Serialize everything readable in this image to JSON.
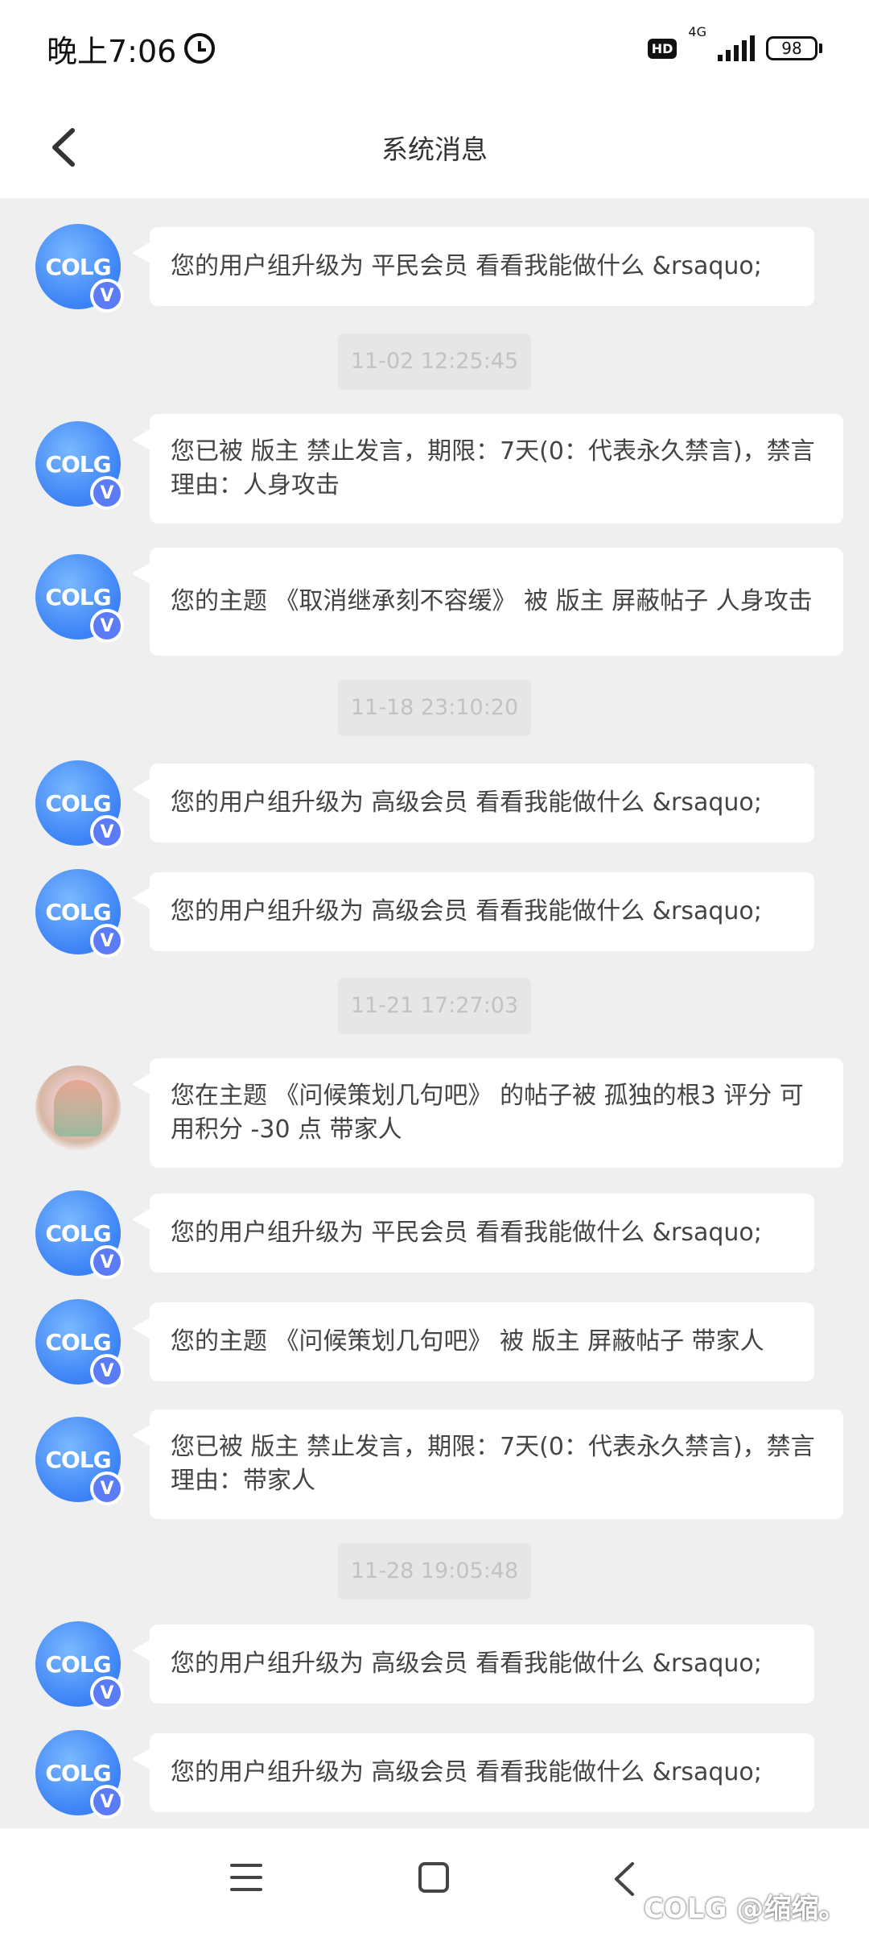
{
  "status_bar": {
    "time": "晚上7:06",
    "hd": "HD",
    "network": "4G",
    "battery": "98"
  },
  "header": {
    "title": "系统消息"
  },
  "messages": [
    {
      "type": "message",
      "text": "您的用户组升级为 平民会员  看看我能做什么 &rsaquo;"
    },
    {
      "type": "time",
      "text": "11-02 12:25:45"
    },
    {
      "type": "message",
      "text": "您已被 版主 禁止发言，期限：7天(0：代表永久禁言)，禁言理由：人身攻击"
    },
    {
      "type": "message",
      "text": "您的主题 《取消继承刻不容缓》 被 版主 屏蔽帖子 人身攻击"
    },
    {
      "type": "time",
      "text": "11-18 23:10:20"
    },
    {
      "type": "message",
      "text": "您的用户组升级为 高级会员  看看我能做什么 &rsaquo;"
    },
    {
      "type": "message",
      "text": "您的用户组升级为 高级会员  看看我能做什么 &rsaquo;"
    },
    {
      "type": "time",
      "text": "11-21 17:27:03"
    },
    {
      "type": "message",
      "text": "您在主题 《问候策划几句吧》 的帖子被 孤独的根3 评分 可用积分 -30 点 带家人"
    },
    {
      "type": "message",
      "text": "您的用户组升级为 平民会员  看看我能做什么 &rsaquo;"
    },
    {
      "type": "message",
      "text": "您的主题 《问候策划几句吧》 被 版主 屏蔽帖子 带家人"
    },
    {
      "type": "message",
      "text": "您已被 版主 禁止发言，期限：7天(0：代表永久禁言)，禁言理由：带家人"
    },
    {
      "type": "time",
      "text": "11-28 19:05:48"
    },
    {
      "type": "message",
      "text": "您的用户组升级为 高级会员  看看我能做什么 &rsaquo;"
    },
    {
      "type": "message",
      "text": "您的用户组升级为 高级会员  看看我能做什么 &rsaquo;"
    }
  ],
  "avatar_logo": "COLG",
  "verify_badge": "V",
  "watermark": "COLG @缩缩。"
}
